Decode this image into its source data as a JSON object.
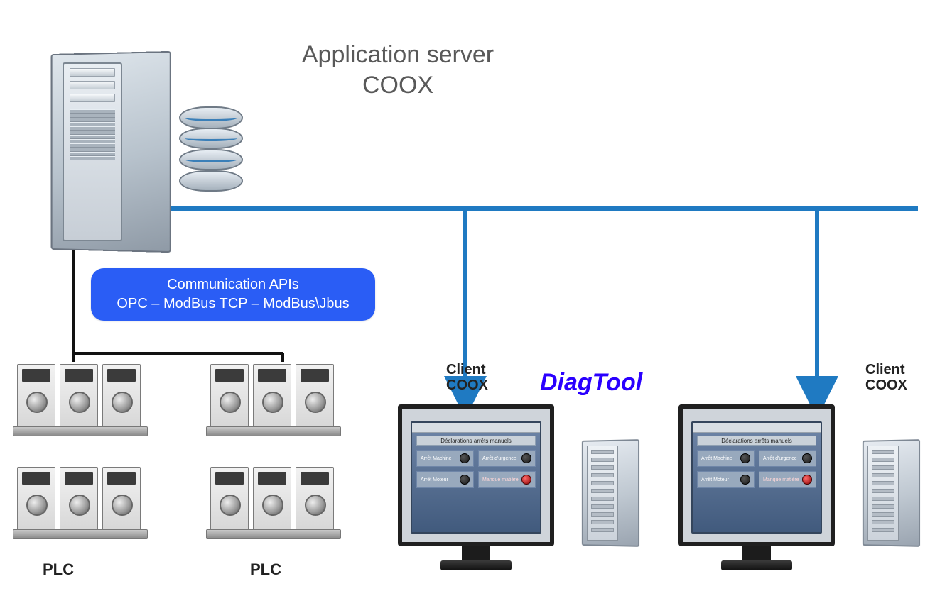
{
  "title_line1": "Application server",
  "title_line2": "COOX",
  "comm": {
    "line1": "Communication APIs",
    "line2": "OPC – ModBus TCP – ModBus\\Jbus"
  },
  "plc_label": "PLC",
  "client_label_line1": "Client",
  "client_label_line2": "COOX",
  "brand": "DiagTool",
  "screen": {
    "header": "Déclarations arrêts manuels",
    "button_a": "Arrêt Machine",
    "button_b": "Arrêt d'urgence",
    "button_c": "Arrêt Moteur",
    "button_d": "Manque matière"
  },
  "colors": {
    "network_line": "#1f7ac2",
    "wire": "#111111",
    "comm_box": "#2a5df5",
    "brand_text": "#2a00ff",
    "title_text": "#595959"
  }
}
